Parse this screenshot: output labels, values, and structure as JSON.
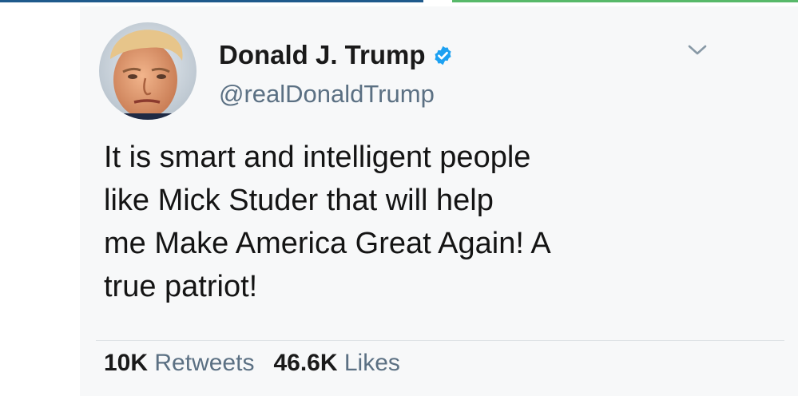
{
  "tweet": {
    "author": {
      "display_name": "Donald J. Trump",
      "handle": "@realDonaldTrump",
      "verified_icon": "verified-badge-icon"
    },
    "text_lines": [
      "It is smart and intelligent people",
      "like Mick Studer that will help",
      "me Make America Great Again! A",
      "true patriot!"
    ],
    "stats": {
      "retweets_count": "10K",
      "retweets_label": "Retweets",
      "likes_count": "46.6K",
      "likes_label": "Likes"
    }
  },
  "colors": {
    "accent": "#1da1f2",
    "secondary_text": "#5b7083",
    "card_background": "#f7f8f9"
  }
}
